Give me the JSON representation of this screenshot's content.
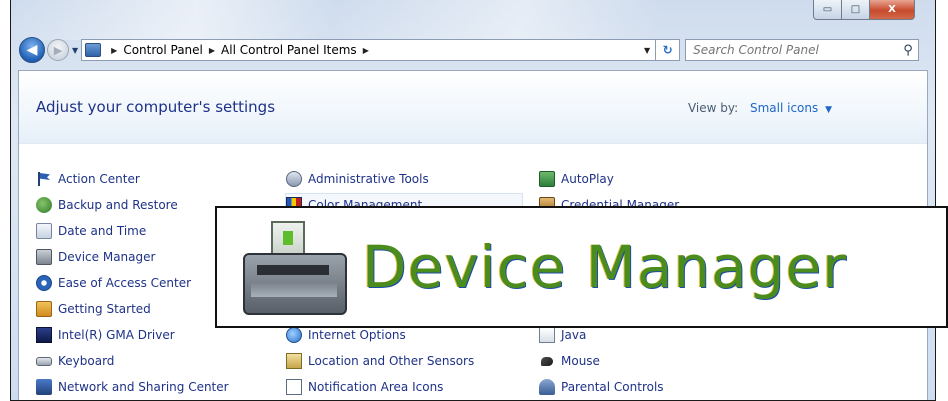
{
  "window": {
    "caption": {
      "minimize_glyph": "▭",
      "maximize_glyph": "□",
      "close_glyph": "X"
    }
  },
  "nav": {
    "back_glyph": "◀",
    "forward_glyph": "▶",
    "history_glyph": "▼",
    "breadcrumbs": [
      "Control Panel",
      "All Control Panel Items"
    ],
    "separator_glyph": "▶",
    "dropdown_glyph": "▼",
    "refresh_glyph": "↻",
    "search_placeholder": "Search Control Panel",
    "search_glyph": "⚲"
  },
  "header": {
    "title": "Adjust your computer's settings",
    "view_by_label": "View by:",
    "view_by_value": "Small icons",
    "view_by_caret": "▼"
  },
  "items": {
    "col1": [
      {
        "label": "Action Center",
        "icon": "action-center-flag-icon"
      },
      {
        "label": "Backup and Restore",
        "icon": "backup-restore-icon"
      },
      {
        "label": "Date and Time",
        "icon": "date-time-icon"
      },
      {
        "label": "Device Manager",
        "icon": "device-manager-icon"
      },
      {
        "label": "Ease of Access Center",
        "icon": "ease-of-access-icon"
      },
      {
        "label": "Getting Started",
        "icon": "getting-started-icon"
      },
      {
        "label": "Intel(R) GMA Driver",
        "icon": "intel-gma-icon"
      },
      {
        "label": "Keyboard",
        "icon": "keyboard-icon"
      },
      {
        "label": "Network and Sharing Center",
        "icon": "network-sharing-icon"
      }
    ],
    "col2": [
      {
        "label": "Administrative Tools",
        "icon": "administrative-tools-icon"
      },
      {
        "label": "Color Management",
        "icon": "color-management-icon"
      },
      {
        "label": "Internet Options",
        "icon": "internet-options-icon"
      },
      {
        "label": "Location and Other Sensors",
        "icon": "location-sensors-icon"
      },
      {
        "label": "Notification Area Icons",
        "icon": "notification-area-icon"
      }
    ],
    "col3": [
      {
        "label": "AutoPlay",
        "icon": "autoplay-icon"
      },
      {
        "label": "Credential Manager",
        "icon": "credential-manager-icon"
      },
      {
        "label": "Java",
        "icon": "java-icon"
      },
      {
        "label": "Mouse",
        "icon": "mouse-icon"
      },
      {
        "label": "Parental Controls",
        "icon": "parental-controls-icon"
      }
    ]
  },
  "callout": {
    "label": "Device Manager",
    "icon": "device-manager-icon"
  }
}
